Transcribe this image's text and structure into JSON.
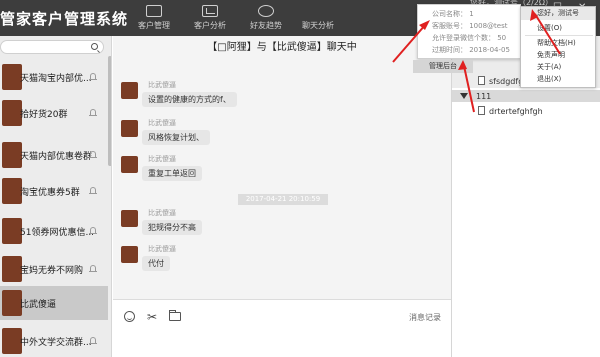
{
  "app": {
    "title": "管家客户管理系统"
  },
  "nav": [
    {
      "label": "客户管理",
      "icon": "id-card-icon"
    },
    {
      "label": "客户分析",
      "icon": "chart-icon"
    },
    {
      "label": "好友趋势",
      "icon": "trend-icon"
    },
    {
      "label": "聊天分析",
      "icon": "chat-icon"
    }
  ],
  "header": {
    "user_line": "您好，测试号（2/2Ω）",
    "minimize": "—",
    "maximize": "☐",
    "close": "✕"
  },
  "sidebar": {
    "search_placeholder": "",
    "groups": [
      {
        "name": "天猫淘宝内部优..."
      },
      {
        "name": "拾好货20群"
      },
      {
        "name": "天猫内部优惠卷群"
      },
      {
        "name": "淘宝优惠券5群"
      },
      {
        "name": "51领券网优惠信..."
      },
      {
        "name": "宝妈无券不网购"
      },
      {
        "name": "比武傻逼"
      },
      {
        "name": "中外文学交流群..."
      }
    ]
  },
  "chat": {
    "title": "【□阿狸】与【比武傻逼】聊天中",
    "messages": [
      {
        "sender": "比武傻逼",
        "text": "设置的健康的方式的f、"
      },
      {
        "sender": "比武傻逼",
        "text": "风格恢复计划、"
      },
      {
        "sender": "比武傻逼",
        "text": "重复工单返回"
      },
      {
        "sender": "比武傻逼",
        "text": "犯规得分不高"
      },
      {
        "sender": "比武傻逼",
        "text": "代付"
      }
    ],
    "timestamp": "2017-04-21 20:10:59",
    "history_label": "消息记录"
  },
  "right_panel": {
    "tree": [
      {
        "label": "sfsdgdfg"
      },
      {
        "label": "111"
      },
      {
        "label": "drtertefghfgh"
      }
    ]
  },
  "info_card": {
    "company_id": "公司名称： 1",
    "service_account": "客服账号： 1008@test",
    "max_pub_count": "允许登录微信个数： 50",
    "expire_date": "过期时间： 2018-04-05",
    "admin_button": "管理后台"
  },
  "menu": {
    "header": "您好，测试号",
    "items": [
      "设置(O)",
      "帮助文档(H)",
      "免责声明",
      "关于(A)",
      "退出(X)"
    ]
  },
  "colors": {
    "topbar": "#3d3d3d",
    "accent_arrow": "#e02020",
    "avatar": "#7a3c24"
  }
}
